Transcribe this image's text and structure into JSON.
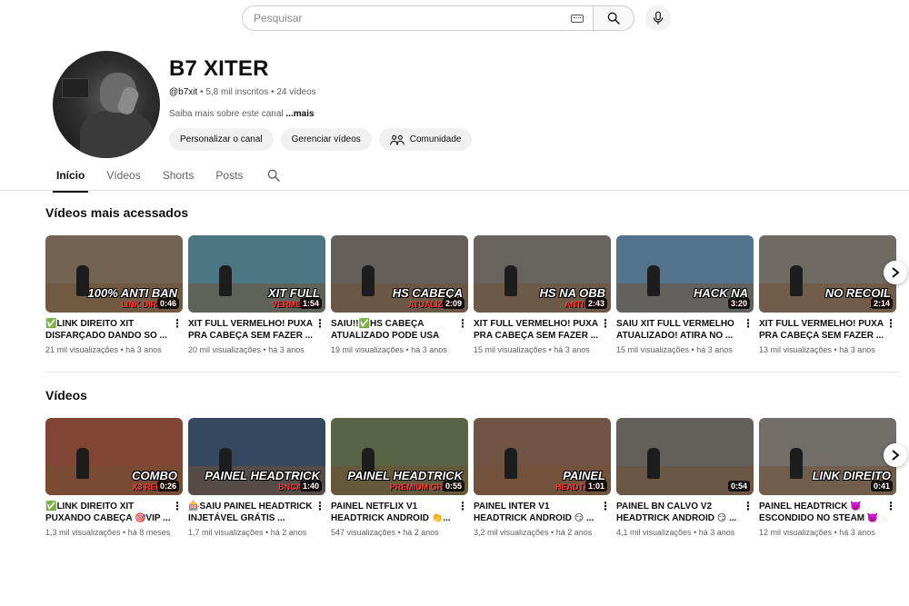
{
  "search": {
    "placeholder": "Pesquisar"
  },
  "channel": {
    "name": "B7 XITER",
    "handle": "@b7xit",
    "subscribers": "5,8 mil inscritos",
    "video_count": "24 vídeos",
    "separator": " • ",
    "description": "Saiba mais sobre este canal ",
    "more": "...mais",
    "actions": [
      {
        "label": "Personalizar o canal"
      },
      {
        "label": "Gerenciar vídeos"
      },
      {
        "label": "Comunidade"
      }
    ]
  },
  "tabs": [
    {
      "label": "Início",
      "active": true
    },
    {
      "label": "Vídeos",
      "active": false
    },
    {
      "label": "Shorts",
      "active": false
    },
    {
      "label": "Posts",
      "active": false
    }
  ],
  "sections": [
    {
      "title": "Vídeos mais acessados",
      "videos": [
        {
          "title": "✅LINK DIREITO XIT DISFARÇADO DANDO SO ...",
          "duration": "0:46",
          "views": "21 mil visualizações",
          "age": "há 3 anos",
          "caption": "100% ANTI BAN",
          "caption_sub": "LINK DIREITO",
          "bg": "#6a5a48"
        },
        {
          "title": "XIT FULL VERMELHO! PUXA PRA CABEÇA SEM FAZER ...",
          "duration": "1:54",
          "views": "20 mil visualizações",
          "age": "há 3 anos",
          "caption": "XIT FULL",
          "caption_sub": "VERMELHO",
          "bg": "#3f6f7c"
        },
        {
          "title": "SAIU!!✅HS CABEÇA ATUALIZADO PODE USA NA...",
          "duration": "2:09",
          "views": "19 mil visualizações",
          "age": "há 3 anos",
          "caption": "HS CABEÇA",
          "caption_sub": "ATUALIZADO",
          "bg": "#5b5650"
        },
        {
          "title": "XIT FULL VERMELHO! PUXA PRA CABEÇA SEM FAZER ...",
          "duration": "2:43",
          "views": "15 mil visualizações",
          "age": "há 3 anos",
          "caption": "HS NA OBB",
          "caption_sub": "ANTI BAN",
          "bg": "#5e5a54"
        },
        {
          "title": "SAIU XIT FULL VERMELHO ATUALIZADO! ATIRA NO ...",
          "duration": "3:20",
          "views": "15 mil visualizações",
          "age": "há 3 anos",
          "caption": "HACK NA",
          "caption_sub": "OBB",
          "bg": "#4a6b86"
        },
        {
          "title": "XIT FULL VERMELHO! PUXA PRA CABEÇA SEM FAZER ...",
          "duration": "2:14",
          "views": "13 mil visualizações",
          "age": "há 3 anos",
          "caption": "NO RECOIL",
          "caption_sub": "100%",
          "bg": "#67615a"
        }
      ]
    },
    {
      "title": "Vídeos",
      "videos": [
        {
          "title": "✅LINK DIREITO XIT PUXANDO CABEÇA 🎯VIP ...",
          "duration": "0:26",
          "views": "1,3 mil visualizações",
          "age": "há 8 meses",
          "caption": "COMBO",
          "caption_sub": "X3 RECOIL",
          "bg": "#7a3a2a"
        },
        {
          "title": "🎰SAIU PAINEL HEADTRICK INJETÁVEL GRÁTIS ...",
          "duration": "1:40",
          "views": "1,7 mil visualizações",
          "age": "há 2 anos",
          "caption": "PAINEL HEADTRICK",
          "caption_sub": "BNCALVO",
          "bg": "#2a3d55"
        },
        {
          "title": "PAINEL NETFLIX V1 HEADTRICK ANDROID 👏...",
          "duration": "0:55",
          "views": "547 visualizações",
          "age": "há 2 anos",
          "caption": "PAINEL HEADTRICK",
          "caption_sub": "PREMIUM GRATIS",
          "bg": "#4f5a3a"
        },
        {
          "title": "PAINEL INTER V1 HEADTRICK ANDROID 😏 ...",
          "duration": "1:01",
          "views": "3,2 mil visualizações",
          "age": "há 2 anos",
          "caption": "PAINEL",
          "caption_sub": "HEADTRICK",
          "bg": "#6a4a3a"
        },
        {
          "title": "PAINEL BN CALVO V2 HEADTRICK ANDROID 😏 ...",
          "duration": "0:54",
          "views": "4,1 mil visualizações",
          "age": "há 3 anos",
          "caption": "",
          "caption_sub": "",
          "bg": "#5a5550"
        },
        {
          "title": "PAINEL HEADTRICK 👿 ESCONDIDO NO STEAM 👿",
          "duration": "0:41",
          "views": "12 mil visualizações",
          "age": "há 3 anos",
          "caption": "LINK DIREITO",
          "caption_sub": "",
          "bg": "#6a6560"
        }
      ]
    }
  ]
}
